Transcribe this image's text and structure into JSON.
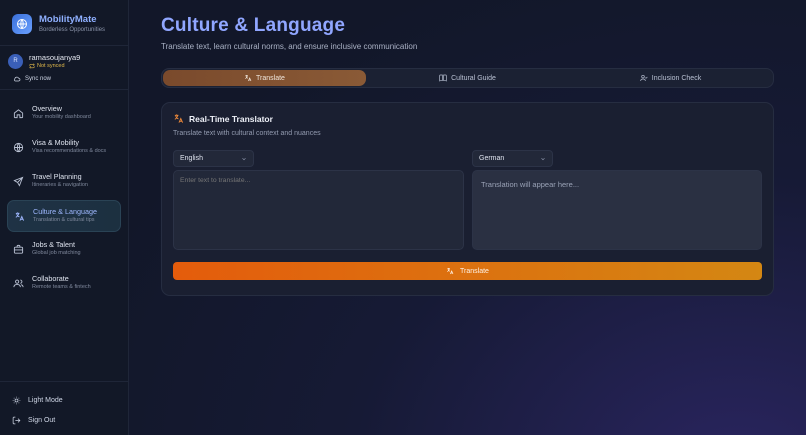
{
  "brand": {
    "title": "MobilityMate",
    "subtitle": "Borderless Opportunities"
  },
  "user": {
    "avatar_initial": "R",
    "name": "ramasoujanya9",
    "status": "Not synced",
    "sync_label": "Sync now"
  },
  "nav": [
    {
      "label": "Overview",
      "sub": "Your mobility dashboard",
      "icon": "home-icon"
    },
    {
      "label": "Visa & Mobility",
      "sub": "Visa recommendations & docs",
      "icon": "globe-icon"
    },
    {
      "label": "Travel Planning",
      "sub": "Itineraries & navigation",
      "icon": "plane-icon"
    },
    {
      "label": "Culture & Language",
      "sub": "Translation & cultural tips",
      "icon": "translate-icon",
      "active": true
    },
    {
      "label": "Jobs & Talent",
      "sub": "Global job matching",
      "icon": "briefcase-icon"
    },
    {
      "label": "Collaborate",
      "sub": "Remote teams & fintech",
      "icon": "users-icon"
    }
  ],
  "bottom": {
    "light_mode": "Light Mode",
    "sign_out": "Sign Out"
  },
  "page": {
    "title": "Culture & Language",
    "subtitle": "Translate text, learn cultural norms, and ensure inclusive communication"
  },
  "tabs": [
    {
      "label": "Translate",
      "active": true
    },
    {
      "label": "Cultural Guide"
    },
    {
      "label": "Inclusion Check"
    }
  ],
  "translator": {
    "title": "Real-Time Translator",
    "subtitle": "Translate text with cultural context and nuances",
    "source_lang": "English",
    "target_lang": "German",
    "input_placeholder": "Enter text to translate...",
    "output_placeholder": "Translation will appear here...",
    "button_label": "Translate"
  },
  "colors": {
    "accent": "#90a6ff",
    "button_start": "#e45c0c",
    "button_end": "#d48713",
    "status_warning": "#e0b84a"
  }
}
